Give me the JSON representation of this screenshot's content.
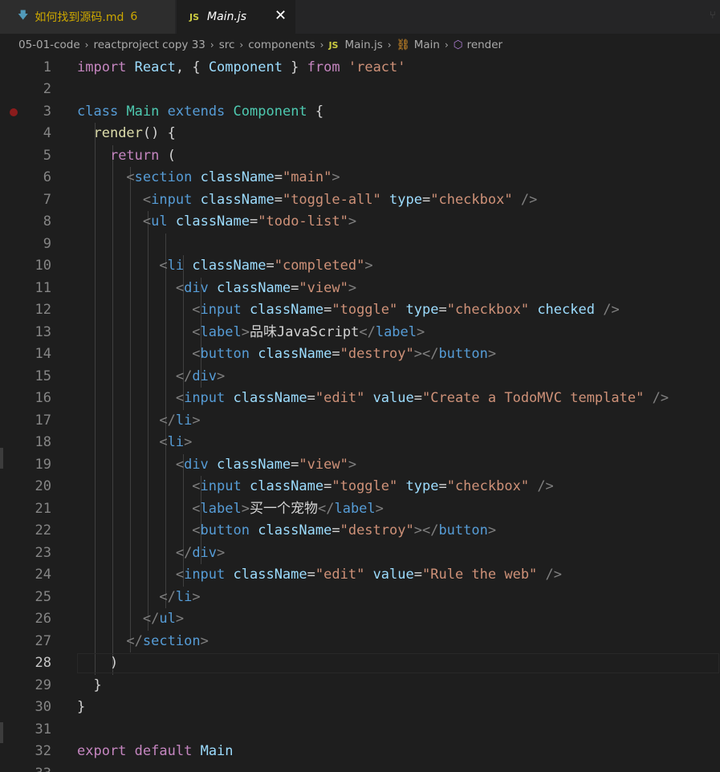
{
  "tabs": [
    {
      "label": "如何找到源码.md",
      "badge": "6",
      "icon": "markdown-icon"
    },
    {
      "label": "Main.js",
      "icon_text": "JS",
      "close": "✕"
    }
  ],
  "breadcrumb": {
    "items": [
      "05-01-code",
      "reactproject copy 33",
      "src",
      "components"
    ],
    "file_icon": "JS",
    "file": "Main.js",
    "symbol1": "Main",
    "symbol2": "render",
    "separator": "›"
  },
  "editor": {
    "active_line": 28,
    "breakpoint_line": 3,
    "lines": [
      {
        "n": "1",
        "tokens": [
          [
            "k",
            "import"
          ],
          [
            "w",
            " "
          ],
          [
            "v",
            "React"
          ],
          [
            "p",
            ", { "
          ],
          [
            "v",
            "Component"
          ],
          [
            "p",
            " } "
          ],
          [
            "k",
            "from"
          ],
          [
            "w",
            " "
          ],
          [
            "s",
            "'react'"
          ]
        ]
      },
      {
        "n": "2",
        "tokens": []
      },
      {
        "n": "3",
        "tokens": [
          [
            "b",
            "class"
          ],
          [
            "w",
            " "
          ],
          [
            "t",
            "Main"
          ],
          [
            "w",
            " "
          ],
          [
            "b",
            "extends"
          ],
          [
            "w",
            " "
          ],
          [
            "t",
            "Component"
          ],
          [
            "p",
            " {"
          ]
        ]
      },
      {
        "n": "4",
        "tokens": [
          [
            "w",
            "  "
          ],
          [
            "f",
            "render"
          ],
          [
            "p",
            "() {"
          ]
        ]
      },
      {
        "n": "5",
        "tokens": [
          [
            "w",
            "    "
          ],
          [
            "k",
            "return"
          ],
          [
            "p",
            " ("
          ]
        ]
      },
      {
        "n": "6",
        "tokens": [
          [
            "w",
            "      "
          ],
          [
            "g",
            "<"
          ],
          [
            "b",
            "section"
          ],
          [
            "w",
            " "
          ],
          [
            "a",
            "className"
          ],
          [
            "p",
            "="
          ],
          [
            "s",
            "\"main\""
          ],
          [
            "g",
            ">"
          ]
        ]
      },
      {
        "n": "7",
        "tokens": [
          [
            "w",
            "        "
          ],
          [
            "g",
            "<"
          ],
          [
            "b",
            "input"
          ],
          [
            "w",
            " "
          ],
          [
            "a",
            "className"
          ],
          [
            "p",
            "="
          ],
          [
            "s",
            "\"toggle-all\""
          ],
          [
            "w",
            " "
          ],
          [
            "a",
            "type"
          ],
          [
            "p",
            "="
          ],
          [
            "s",
            "\"checkbox\""
          ],
          [
            "w",
            " "
          ],
          [
            "g",
            "/>"
          ]
        ]
      },
      {
        "n": "8",
        "tokens": [
          [
            "w",
            "        "
          ],
          [
            "g",
            "<"
          ],
          [
            "b",
            "ul"
          ],
          [
            "w",
            " "
          ],
          [
            "a",
            "className"
          ],
          [
            "p",
            "="
          ],
          [
            "s",
            "\"todo-list\""
          ],
          [
            "g",
            ">"
          ]
        ]
      },
      {
        "n": "9",
        "tokens": []
      },
      {
        "n": "10",
        "tokens": [
          [
            "w",
            "          "
          ],
          [
            "g",
            "<"
          ],
          [
            "b",
            "li"
          ],
          [
            "w",
            " "
          ],
          [
            "a",
            "className"
          ],
          [
            "p",
            "="
          ],
          [
            "s",
            "\"completed\""
          ],
          [
            "g",
            ">"
          ]
        ]
      },
      {
        "n": "11",
        "tokens": [
          [
            "w",
            "            "
          ],
          [
            "g",
            "<"
          ],
          [
            "b",
            "div"
          ],
          [
            "w",
            " "
          ],
          [
            "a",
            "className"
          ],
          [
            "p",
            "="
          ],
          [
            "s",
            "\"view\""
          ],
          [
            "g",
            ">"
          ]
        ]
      },
      {
        "n": "12",
        "tokens": [
          [
            "w",
            "              "
          ],
          [
            "g",
            "<"
          ],
          [
            "b",
            "input"
          ],
          [
            "w",
            " "
          ],
          [
            "a",
            "className"
          ],
          [
            "p",
            "="
          ],
          [
            "s",
            "\"toggle\""
          ],
          [
            "w",
            " "
          ],
          [
            "a",
            "type"
          ],
          [
            "p",
            "="
          ],
          [
            "s",
            "\"checkbox\""
          ],
          [
            "w",
            " "
          ],
          [
            "a",
            "checked"
          ],
          [
            "w",
            " "
          ],
          [
            "g",
            "/>"
          ]
        ]
      },
      {
        "n": "13",
        "tokens": [
          [
            "w",
            "              "
          ],
          [
            "g",
            "<"
          ],
          [
            "b",
            "label"
          ],
          [
            "g",
            ">"
          ],
          [
            "p",
            "品味JavaScript"
          ],
          [
            "g",
            "</"
          ],
          [
            "b",
            "label"
          ],
          [
            "g",
            ">"
          ]
        ]
      },
      {
        "n": "14",
        "tokens": [
          [
            "w",
            "              "
          ],
          [
            "g",
            "<"
          ],
          [
            "b",
            "button"
          ],
          [
            "w",
            " "
          ],
          [
            "a",
            "className"
          ],
          [
            "p",
            "="
          ],
          [
            "s",
            "\"destroy\""
          ],
          [
            "g",
            "></"
          ],
          [
            "b",
            "button"
          ],
          [
            "g",
            ">"
          ]
        ]
      },
      {
        "n": "15",
        "tokens": [
          [
            "w",
            "            "
          ],
          [
            "g",
            "</"
          ],
          [
            "b",
            "div"
          ],
          [
            "g",
            ">"
          ]
        ]
      },
      {
        "n": "16",
        "tokens": [
          [
            "w",
            "            "
          ],
          [
            "g",
            "<"
          ],
          [
            "b",
            "input"
          ],
          [
            "w",
            " "
          ],
          [
            "a",
            "className"
          ],
          [
            "p",
            "="
          ],
          [
            "s",
            "\"edit\""
          ],
          [
            "w",
            " "
          ],
          [
            "a",
            "value"
          ],
          [
            "p",
            "="
          ],
          [
            "s",
            "\"Create a TodoMVC template\""
          ],
          [
            "w",
            " "
          ],
          [
            "g",
            "/>"
          ]
        ]
      },
      {
        "n": "17",
        "tokens": [
          [
            "w",
            "          "
          ],
          [
            "g",
            "</"
          ],
          [
            "b",
            "li"
          ],
          [
            "g",
            ">"
          ]
        ]
      },
      {
        "n": "18",
        "tokens": [
          [
            "w",
            "          "
          ],
          [
            "g",
            "<"
          ],
          [
            "b",
            "li"
          ],
          [
            "g",
            ">"
          ]
        ]
      },
      {
        "n": "19",
        "tokens": [
          [
            "w",
            "            "
          ],
          [
            "g",
            "<"
          ],
          [
            "b",
            "div"
          ],
          [
            "w",
            " "
          ],
          [
            "a",
            "className"
          ],
          [
            "p",
            "="
          ],
          [
            "s",
            "\"view\""
          ],
          [
            "g",
            ">"
          ]
        ]
      },
      {
        "n": "20",
        "tokens": [
          [
            "w",
            "              "
          ],
          [
            "g",
            "<"
          ],
          [
            "b",
            "input"
          ],
          [
            "w",
            " "
          ],
          [
            "a",
            "className"
          ],
          [
            "p",
            "="
          ],
          [
            "s",
            "\"toggle\""
          ],
          [
            "w",
            " "
          ],
          [
            "a",
            "type"
          ],
          [
            "p",
            "="
          ],
          [
            "s",
            "\"checkbox\""
          ],
          [
            "w",
            " "
          ],
          [
            "g",
            "/>"
          ]
        ]
      },
      {
        "n": "21",
        "tokens": [
          [
            "w",
            "              "
          ],
          [
            "g",
            "<"
          ],
          [
            "b",
            "label"
          ],
          [
            "g",
            ">"
          ],
          [
            "p",
            "买一个宠物"
          ],
          [
            "g",
            "</"
          ],
          [
            "b",
            "label"
          ],
          [
            "g",
            ">"
          ]
        ]
      },
      {
        "n": "22",
        "tokens": [
          [
            "w",
            "              "
          ],
          [
            "g",
            "<"
          ],
          [
            "b",
            "button"
          ],
          [
            "w",
            " "
          ],
          [
            "a",
            "className"
          ],
          [
            "p",
            "="
          ],
          [
            "s",
            "\"destroy\""
          ],
          [
            "g",
            "></"
          ],
          [
            "b",
            "button"
          ],
          [
            "g",
            ">"
          ]
        ]
      },
      {
        "n": "23",
        "tokens": [
          [
            "w",
            "            "
          ],
          [
            "g",
            "</"
          ],
          [
            "b",
            "div"
          ],
          [
            "g",
            ">"
          ]
        ]
      },
      {
        "n": "24",
        "tokens": [
          [
            "w",
            "            "
          ],
          [
            "g",
            "<"
          ],
          [
            "b",
            "input"
          ],
          [
            "w",
            " "
          ],
          [
            "a",
            "className"
          ],
          [
            "p",
            "="
          ],
          [
            "s",
            "\"edit\""
          ],
          [
            "w",
            " "
          ],
          [
            "a",
            "value"
          ],
          [
            "p",
            "="
          ],
          [
            "s",
            "\"Rule the web\""
          ],
          [
            "w",
            " "
          ],
          [
            "g",
            "/>"
          ]
        ]
      },
      {
        "n": "25",
        "tokens": [
          [
            "w",
            "          "
          ],
          [
            "g",
            "</"
          ],
          [
            "b",
            "li"
          ],
          [
            "g",
            ">"
          ]
        ]
      },
      {
        "n": "26",
        "tokens": [
          [
            "w",
            "        "
          ],
          [
            "g",
            "</"
          ],
          [
            "b",
            "ul"
          ],
          [
            "g",
            ">"
          ]
        ]
      },
      {
        "n": "27",
        "tokens": [
          [
            "w",
            "      "
          ],
          [
            "g",
            "</"
          ],
          [
            "b",
            "section"
          ],
          [
            "g",
            ">"
          ]
        ]
      },
      {
        "n": "28",
        "tokens": [
          [
            "w",
            "    "
          ],
          [
            "p",
            ")"
          ]
        ]
      },
      {
        "n": "29",
        "tokens": [
          [
            "w",
            "  "
          ],
          [
            "p",
            "}"
          ]
        ]
      },
      {
        "n": "30",
        "tokens": [
          [
            "p",
            "}"
          ]
        ]
      },
      {
        "n": "31",
        "tokens": []
      },
      {
        "n": "32",
        "tokens": [
          [
            "k",
            "export"
          ],
          [
            "w",
            " "
          ],
          [
            "k",
            "default"
          ],
          [
            "w",
            " "
          ],
          [
            "v",
            "Main"
          ]
        ]
      },
      {
        "n": "33",
        "tokens": []
      }
    ]
  }
}
